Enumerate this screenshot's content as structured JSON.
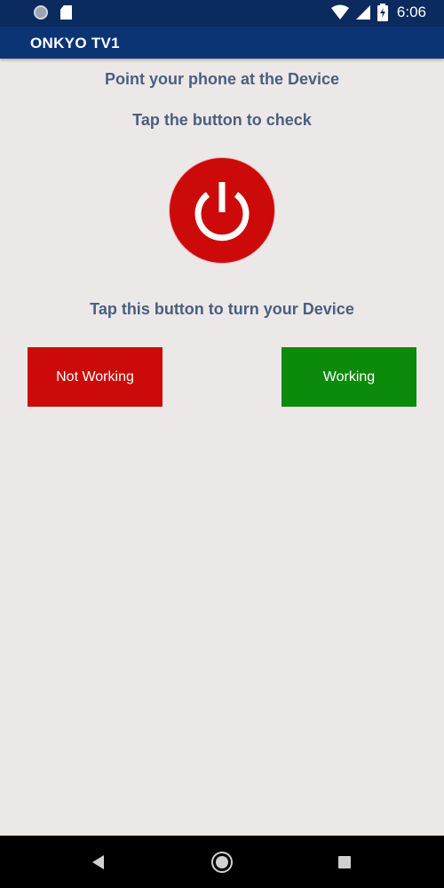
{
  "status_bar": {
    "time": "6:06",
    "icons": [
      "notification-dot-icon",
      "sd-card-icon",
      "wifi-icon",
      "signal-icon",
      "battery-icon"
    ]
  },
  "app_bar": {
    "title": "ONKYO TV1"
  },
  "main": {
    "instruction_1": "Point your phone at the Device",
    "instruction_2": "Tap the button to check",
    "power_icon": "power-icon",
    "instruction_3": "Tap this button to turn your Device",
    "not_working_label": "Not Working",
    "working_label": "Working"
  },
  "colors": {
    "app_bar": "#0b3475",
    "status_bar": "#0b2a5e",
    "background": "#ece8e8",
    "instruction_text": "#4a5f7f",
    "power_red": "#cc0a0a",
    "working_green": "#0b8a0b"
  },
  "nav_bar": {
    "icons": [
      "back-icon",
      "home-icon",
      "recents-icon"
    ]
  }
}
